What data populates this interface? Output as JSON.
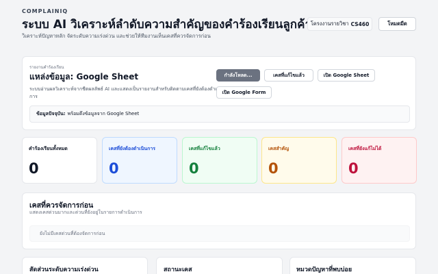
{
  "header": {
    "brand": "COMPLAINIQ",
    "title": "ระบบ AI วิเคราะห์ลำดับความสำคัญของคำร้องเรียนลูกค้า",
    "subtitle": "วิเคราะห์ปัญหาหลัก จัดระดับความเร่งด่วน และช่วยให้ทีมงานเห็นเคสที่ควรจัดการก่อน",
    "course_prefix": "โครงงานรายวิชา",
    "course_code": "CS460",
    "mode_button": "โหมดมืด"
  },
  "source": {
    "kicker": "รายงานคำร้องเรียน",
    "title": "แหล่งข้อมูล: Google Sheet",
    "description": "ระบบอ่านผลวิเคราะห์จากชีตผลลัพธ์ AI และแสดงเป็นรายงานสำหรับติดตามเคสที่ยังต้องดำเนินการ",
    "loading_button": "กำลังโหลด...",
    "resolved_button": "เคสที่แก้ไขแล้ว",
    "open_sheet_button": "เปิด Google Sheet",
    "open_form_button": "เปิด Google Form",
    "status_label": "ข้อมูลปัจจุบัน:",
    "status_text": "พร้อมดึงข้อมูลจาก Google Sheet"
  },
  "stats": {
    "total": {
      "label": "คำร้องเรียนทั้งหมด",
      "value": "0"
    },
    "pending": {
      "label": "เคสที่ยังต้องดำเนินการ",
      "value": "0"
    },
    "resolved": {
      "label": "เคสที่แก้ไขแล้ว",
      "value": "0"
    },
    "important": {
      "label": "เคสสำคัญ",
      "value": "0"
    },
    "unresolvable": {
      "label": "เคสที่ยังแก้ไม่ได้",
      "value": "0"
    }
  },
  "priority": {
    "title": "เคสที่ควรจัดการก่อน",
    "subtitle": "แสดงเคสด่วนมากและด่วนที่ยังอยู่ในรายการดำเนินการ",
    "empty_text": "ยังไม่มีเคสด่วนที่ต้องจัดการก่อน"
  },
  "bottom": {
    "urgency_ratio_title": "สัดส่วนระดับความเร่งด่วน",
    "case_status_title": "สถานะเคส",
    "common_category_title": "หมวดปัญหาที่พบบ่อย"
  },
  "colors": {
    "pending": "#1d4ed8",
    "resolved": "#15803d",
    "important": "#b45309",
    "unresolvable": "#be123c",
    "loading_button": "#6b7280"
  }
}
